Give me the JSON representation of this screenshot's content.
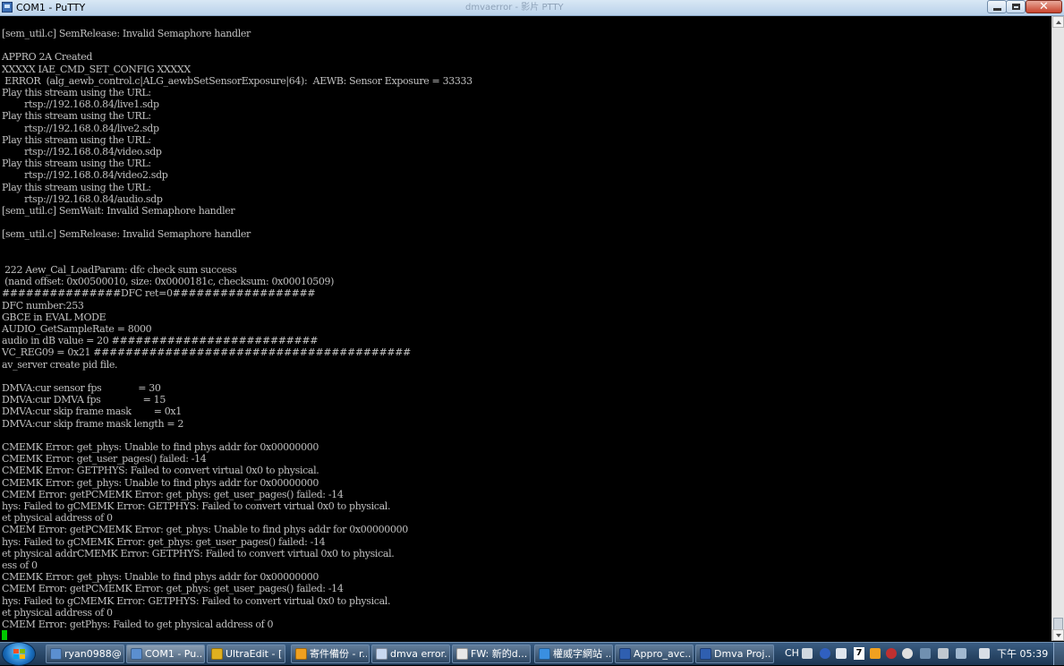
{
  "window": {
    "title": "COM1 - PuTTY",
    "background_title": "dmvaerror - 影片 PTTY"
  },
  "terminal": {
    "lines": [
      "[sem_util.c] SemRelease: Invalid Semaphore handler",
      "",
      "APPRO 2A Created",
      "XXXXX IAE_CMD_SET_CONFIG XXXXX",
      " ERROR  (alg_aewb_control.c|ALG_aewbSetSensorExposure|64):  AEWB: Sensor Exposure = 33333",
      "Play this stream using the URL:",
      "        rtsp://192.168.0.84/live1.sdp",
      "Play this stream using the URL:",
      "        rtsp://192.168.0.84/live2.sdp",
      "Play this stream using the URL:",
      "        rtsp://192.168.0.84/video.sdp",
      "Play this stream using the URL:",
      "        rtsp://192.168.0.84/video2.sdp",
      "Play this stream using the URL:",
      "        rtsp://192.168.0.84/audio.sdp",
      "[sem_util.c] SemWait: Invalid Semaphore handler",
      "",
      "[sem_util.c] SemRelease: Invalid Semaphore handler",
      "",
      "",
      " 222 Aew_Cal_LoadParam: dfc check sum success",
      " (nand offset: 0x00500010, size: 0x0000181c, checksum: 0x00010509)",
      "###############DFC ret=0##################",
      "DFC number:253",
      "GBCE in EVAL MODE",
      "AUDIO_GetSampleRate = 8000",
      "audio in dB value = 20 ##########################",
      "VC_REG09 = 0x21 ########################################",
      "av_server create pid file.",
      "",
      "DMVA:cur sensor fps             = 30",
      "DMVA:cur DMVA fps               = 15",
      "DMVA:cur skip frame mask        = 0x1",
      "DMVA:cur skip frame mask length = 2",
      "",
      "CMEMK Error: get_phys: Unable to find phys addr for 0x00000000",
      "CMEMK Error: get_user_pages() failed: -14",
      "CMEMK Error: GETPHYS: Failed to convert virtual 0x0 to physical.",
      "CMEMK Error: get_phys: Unable to find phys addr for 0x00000000",
      "CMEM Error: getPCMEMK Error: get_phys: get_user_pages() failed: -14",
      "hys: Failed to gCMEMK Error: GETPHYS: Failed to convert virtual 0x0 to physical.",
      "et physical address of 0",
      "CMEM Error: getPCMEMK Error: get_phys: Unable to find phys addr for 0x00000000",
      "hys: Failed to gCMEMK Error: get_phys: get_user_pages() failed: -14",
      "et physical addrCMEMK Error: GETPHYS: Failed to convert virtual 0x0 to physical.",
      "ess of 0",
      "CMEMK Error: get_phys: Unable to find phys addr for 0x00000000",
      "CMEM Error: getPCMEMK Error: get_phys: get_user_pages() failed: -14",
      "hys: Failed to gCMEMK Error: GETPHYS: Failed to convert virtual 0x0 to physical.",
      "et physical address of 0",
      "CMEM Error: getPhys: Failed to get physical address of 0"
    ]
  },
  "taskbar": {
    "items": [
      {
        "label": "ryan0988@...",
        "icon": "putty-icon",
        "color": "#5b8fd0"
      },
      {
        "label": "COM1 - Pu...",
        "icon": "putty-icon",
        "color": "#5b8fd0"
      },
      {
        "label": "UltraEdit - [...",
        "icon": "ultraedit-icon",
        "color": "#e0b020"
      },
      {
        "label": "寄件備份 - r...",
        "icon": "outlook-icon",
        "color": "#f0a020"
      },
      {
        "label": "dmva error...",
        "icon": "paint-icon",
        "color": "#c8d8f0"
      },
      {
        "label": "FW: 新的d...",
        "icon": "mail-icon",
        "color": "#e8e8e8"
      },
      {
        "label": "權威字網站 ...",
        "icon": "ie-icon",
        "color": "#3a8fe0"
      },
      {
        "label": "Appro_avc...",
        "icon": "word-icon",
        "color": "#2f5fb0"
      },
      {
        "label": "Dmva Proj...",
        "icon": "word-icon",
        "color": "#2f5fb0"
      }
    ],
    "tray": {
      "lang": "CH",
      "num_badge": "7"
    },
    "clock": "下午 05:39"
  },
  "colors": {
    "terminal_bg": "#000000",
    "terminal_fg": "#c0c0c0",
    "cursor": "#00c800"
  }
}
